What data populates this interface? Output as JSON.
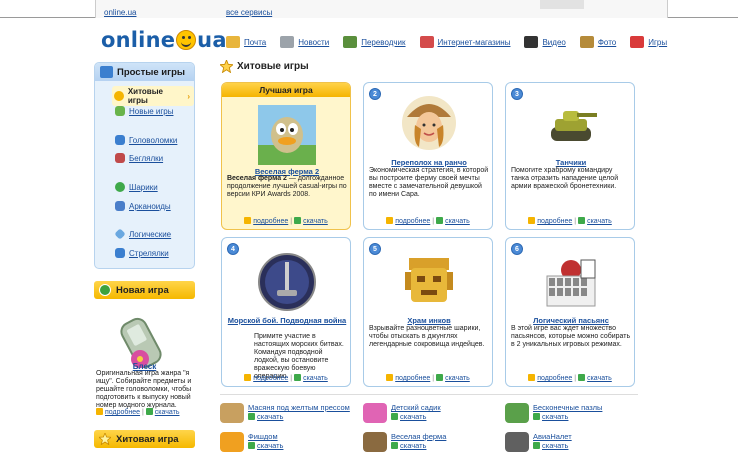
{
  "topbar": {
    "site": "online.ua",
    "services": "все сервисы"
  },
  "header": {
    "logo_left": "online",
    "logo_right": "ua",
    "nav": [
      {
        "label": "Почта",
        "icon": "mail-icon",
        "color": "#e8b53c"
      },
      {
        "label": "Новости",
        "icon": "newspaper-icon",
        "color": "#9ca3aa"
      },
      {
        "label": "Переводчик",
        "icon": "translator-icon",
        "color": "#5a8f3c"
      },
      {
        "label": "Интернет-магазины",
        "icon": "shop-icon",
        "color": "#d44b4b"
      },
      {
        "label": "Видео",
        "icon": "video-icon",
        "color": "#333333"
      },
      {
        "label": "Фото",
        "icon": "camera-icon",
        "color": "#b58b3a"
      },
      {
        "label": "Игры",
        "icon": "games-icon",
        "color": "#d93a3a"
      }
    ]
  },
  "sidebar": {
    "title": "Простые игры",
    "items": [
      {
        "label": "Хитовые игры",
        "icon": "star-icon",
        "color": "#f5b400"
      },
      {
        "label": "Новые игры",
        "icon": "new-icon",
        "color": "#69b44b"
      },
      {
        "label": "Головоломки",
        "icon": "puzzle-icon",
        "color": "#3b7fcf"
      },
      {
        "label": "Беглялки",
        "icon": "runner-icon",
        "color": "#c04a4a"
      },
      {
        "label": "Шарики",
        "icon": "ball-icon",
        "color": "#3ea94a"
      },
      {
        "label": "Арканоиды",
        "icon": "arkanoid-icon",
        "color": "#4a7ec9"
      },
      {
        "label": "Логические",
        "icon": "diamond-icon",
        "color": "#6aa8e0"
      },
      {
        "label": "Стрелялки",
        "icon": "shooter-icon",
        "color": "#3b7fcf"
      }
    ]
  },
  "new_game": {
    "title": "Новая игра",
    "game_title": "Блеск",
    "description": "Оригинальная игра жанра \"я ищу\". Собирайте предметы и решайте головоломки, чтобы подготовить к выпуску новый номер модного журнала.",
    "more": "подробнее",
    "download": "скачать"
  },
  "hit_game": {
    "title": "Хитовая игра"
  },
  "main": {
    "title": "Хитовые игры",
    "best_label": "Лучшая игра",
    "more": "подробнее",
    "download": "скачать",
    "cards": [
      {
        "num": "",
        "title": "Веселая ферма 2",
        "bold": "Веселая ферма 2",
        "desc": " — долгожданное продолжение лучшей casual-игры по версии КРИ Awards 2008."
      },
      {
        "num": "2",
        "title": "Переполох на ранчо",
        "bold": "",
        "desc": "Экономическая стратегия, в которой вы построите ферму своей мечты вместе с замечательной девушкой по имени Сара."
      },
      {
        "num": "3",
        "title": "Танчики",
        "bold": "",
        "desc": "Помогите храброму командиру танка отразить нападение целой армии вражеской бронетехники."
      },
      {
        "num": "4",
        "title": "Морской бой. Подводная война",
        "bold": "",
        "desc": "Примите участие в настоящих морских битвах. Командуя подводной лодкой, вы остановите вражескую боевую операцию."
      },
      {
        "num": "5",
        "title": "Храм инков",
        "bold": "",
        "desc": "Взрывайте разноцветные шарики, чтобы отыскать в джунглях легендарные сокровища индейцев."
      },
      {
        "num": "6",
        "title": "Логический пасьянс",
        "bold": "",
        "desc": "В этой игре вас ждет множество пасьянсов, которые можно собирать в 2 уникальных игровых режимах."
      }
    ],
    "list": [
      {
        "title": "Масяня под желтым прессом",
        "download": "скачать",
        "color": "#c8a060"
      },
      {
        "title": "Детский садик",
        "download": "скачать",
        "color": "#e064b4"
      },
      {
        "title": "Бесконечные пазлы",
        "download": "скачать",
        "color": "#5aa04a"
      },
      {
        "title": "Фишдом",
        "download": "скачать",
        "color": "#f0a020"
      },
      {
        "title": "Веселая ферма",
        "download": "скачать",
        "color": "#8a6a40"
      },
      {
        "title": "АвиаНалет",
        "download": "скачать",
        "color": "#606060"
      }
    ]
  }
}
